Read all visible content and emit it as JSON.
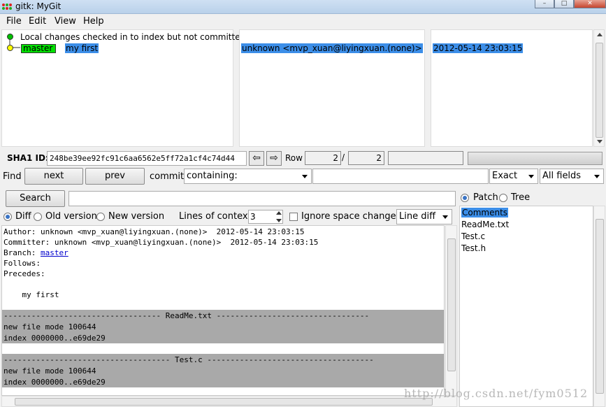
{
  "window": {
    "title": "gitk: MyGit",
    "minimize_glyph": "–",
    "maximize_glyph": "□",
    "close_glyph": "✕"
  },
  "menu": [
    "File",
    "Edit",
    "View",
    "Help"
  ],
  "commits": {
    "local_changes": "Local changes checked in to index but not committed",
    "branch": "master",
    "message": "my first",
    "author": "unknown <mvp_xuan@liyingxuan.(none)>",
    "date": "2012-05-14 23:03:15"
  },
  "sha": {
    "label": "SHA1 ID:",
    "value": "248be39ee92fc91c6aa6562e5ff72a1cf4c74d44",
    "row_label": "Row",
    "row_current": "2",
    "row_sep": "/",
    "row_total": "2",
    "back_glyph": "⇦",
    "forward_glyph": "⇨"
  },
  "find": {
    "label": "Find",
    "next": "next",
    "prev": "prev",
    "commit_label": "commit",
    "mode": "containing:",
    "match": "Exact",
    "fields": "All fields"
  },
  "search": {
    "button": "Search"
  },
  "diff_opts": {
    "diff": "Diff",
    "old_version": "Old version",
    "new_version": "New version",
    "context_label": "Lines of context:",
    "context_value": "3",
    "ignore_space": "Ignore space change",
    "line_diff": "Line diff"
  },
  "diff": {
    "author": "Author: unknown <mvp_xuan@liyingxuan.(none)>  2012-05-14 23:03:15",
    "committer": "Committer: unknown <mvp_xuan@liyingxuan.(none)>  2012-05-14 23:03:15",
    "branch_label": "Branch: ",
    "branch_link": "master",
    "follows": "Follows:",
    "precedes": "Precedes:",
    "message": "    my first",
    "file1_header": "---------------------------------- ReadMe.txt ---------------------------------",
    "file1_mode": "new file mode 100644",
    "file1_index": "index 0000000..e69de29",
    "file2_header": "------------------------------------ Test.c ------------------------------------",
    "file2_mode": "new file mode 100644",
    "file2_index": "index 0000000..e69de29"
  },
  "file_panel": {
    "patch": "Patch",
    "tree": "Tree",
    "files": [
      "Comments",
      "ReadMe.txt",
      "Test.c",
      "Test.h"
    ]
  },
  "watermark": "http://blog.csdn.net/fym0512",
  "colors": {
    "selection": "#3c8ee8",
    "branch_tag": "#00e000",
    "file_band": "#a9a9a9",
    "node": "#00c000",
    "head_node": "#ffff00"
  }
}
